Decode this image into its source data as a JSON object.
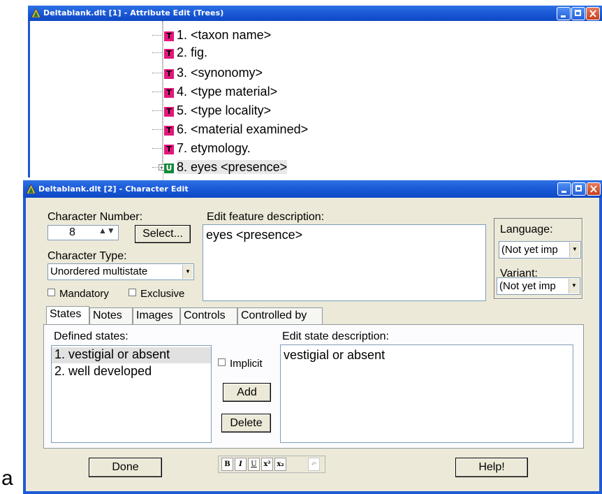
{
  "tree_window": {
    "title": "Deltablank.dlt [1] - Attribute Edit (Trees)",
    "nodes": [
      {
        "badge": "T",
        "label": "1. <taxon name>"
      },
      {
        "badge": "T",
        "label": "2. fig."
      },
      {
        "badge": "T",
        "label": "3. <synonomy>"
      },
      {
        "badge": "T",
        "label": "4. <type material>"
      },
      {
        "badge": "T",
        "label": "5. <type locality>"
      },
      {
        "badge": "T",
        "label": "6. <material examined>"
      },
      {
        "badge": "T",
        "label": "7. etymology."
      },
      {
        "badge": "U",
        "label": "8. eyes <presence>",
        "expander": "+"
      }
    ]
  },
  "char_window": {
    "title": "Deltablank.dlt [2] - Character Edit",
    "char_number_label": "Character Number:",
    "char_number_value": "8",
    "select_button": "Select...",
    "char_type_label": "Character Type:",
    "char_type_value": "Unordered multistate",
    "mandatory_label": "Mandatory",
    "exclusive_label": "Exclusive",
    "feature_label": "Edit feature description:",
    "feature_value": "eyes <presence>",
    "language_label": "Language:",
    "language_value": "(Not yet imp",
    "variant_label": "Variant:",
    "variant_value": "(Not yet imp",
    "tabs": [
      "States",
      "Notes",
      "Images",
      "Controls",
      "Controlled by"
    ],
    "defined_states_label": "Defined states:",
    "states": [
      "1. vestigial or absent",
      "2. well developed"
    ],
    "implicit_label": "Implicit",
    "add_button": "Add",
    "delete_button": "Delete",
    "state_desc_label": "Edit state description:",
    "state_desc_value": "vestigial or absent",
    "done_button": "Done",
    "help_button": "Help!",
    "format_buttons": [
      "B",
      "I",
      "U",
      "x²",
      "x₂",
      "↶"
    ]
  },
  "figure_label": "a",
  "colors": {
    "titlebar": "#1c5bd8",
    "badge_t": "#e2177b",
    "badge_u": "#138a3a",
    "window_bg": "#ece9d8"
  }
}
